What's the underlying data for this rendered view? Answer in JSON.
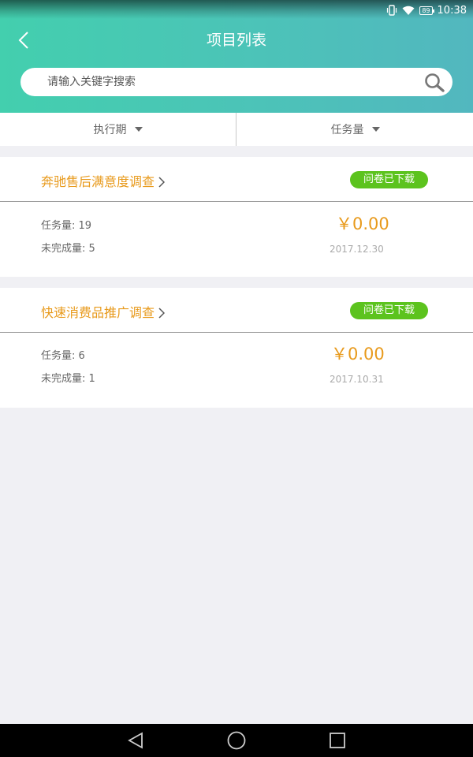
{
  "status_bar": {
    "battery": "89",
    "time": "10:38",
    "icons": [
      "vibrate-icon",
      "wifi-icon",
      "battery-icon"
    ]
  },
  "header": {
    "title": "项目列表",
    "back_icon": "chevron-left-icon"
  },
  "search": {
    "placeholder": "请输入关键字搜索",
    "icon": "search-icon"
  },
  "filters": [
    {
      "label": "执行期",
      "icon": "triangle-down-icon"
    },
    {
      "label": "任务量",
      "icon": "triangle-down-icon"
    }
  ],
  "projects": [
    {
      "title": "奔驰售后满意度调查",
      "badge": "问卷已下载",
      "task_label": "任务量:",
      "task_value": "19",
      "remaining_label": "未完成量:",
      "remaining_value": "5",
      "price": "￥0.00",
      "date": "2017.12.30"
    },
    {
      "title": "快速消费品推广调查",
      "badge": "问卷已下载",
      "task_label": "任务量:",
      "task_value": "6",
      "remaining_label": "未完成量:",
      "remaining_value": "1",
      "price": "￥0.00",
      "date": "2017.10.31"
    }
  ],
  "nav_bar": {
    "icons": [
      "back-triangle-icon",
      "home-circle-icon",
      "recents-square-icon"
    ]
  },
  "colors": {
    "header_start": "#43cfae",
    "header_end": "#52b7bf",
    "accent_orange": "#e89a1c",
    "badge_green": "#5cc31e",
    "page_bg": "#f0f0f4"
  }
}
